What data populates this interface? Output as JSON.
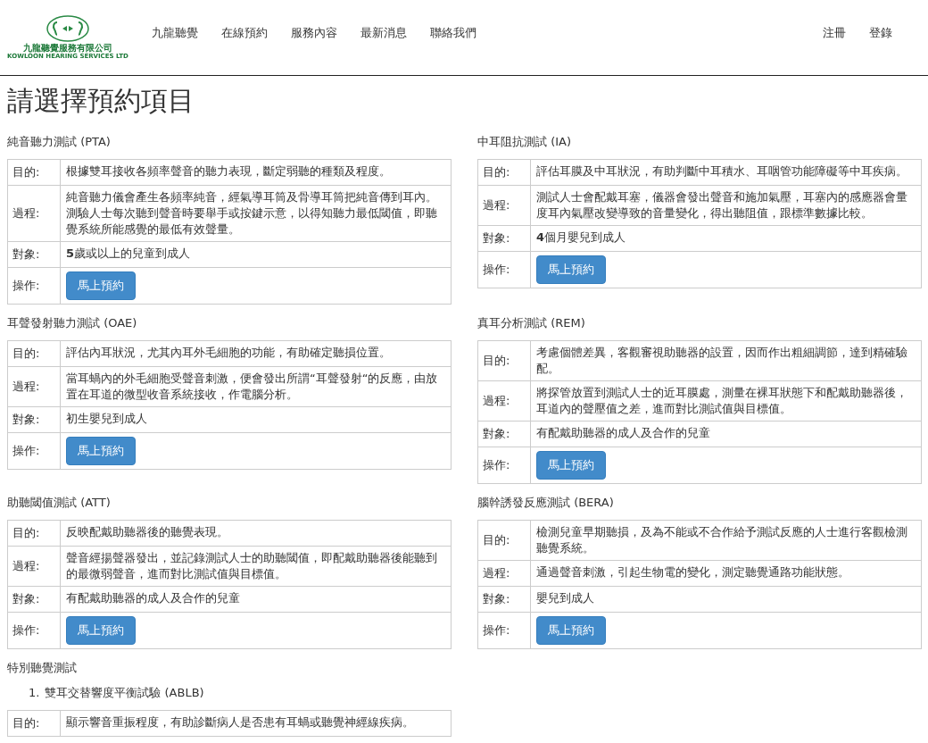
{
  "header": {
    "logo": {
      "name_zh": "九龍聽覺服務有限公司",
      "name_en": "KOWLOON HEARING SERVICES LTD"
    },
    "nav": [
      {
        "label": "九龍聽覺"
      },
      {
        "label": "在線預約"
      },
      {
        "label": "服務內容"
      },
      {
        "label": "最新消息"
      },
      {
        "label": "聯絡我們"
      }
    ],
    "account": [
      {
        "label": "注冊"
      },
      {
        "label": "登錄"
      }
    ]
  },
  "title": "請選擇預約項目",
  "tests": [
    {
      "title": "純音聽力測試 (PTA)",
      "rows": [
        {
          "kind": "text",
          "label": "目的:",
          "text": "根據雙耳接收各頻率聲音的聽力表現，斷定弱聽的種類及程度。"
        },
        {
          "kind": "text",
          "label": "過程:",
          "text": "純音聽力儀會產生各頻率純音，經氣導耳筒及骨導耳筒把純音傳到耳內。測驗人士每次聽到聲音時要舉手或按鍵示意，以得知聽力最低閾值，即聽覺系統所能感覺的最低有效聲量。"
        },
        {
          "kind": "text",
          "label": "對象:",
          "text": "**5**歲或以上的兒童到成人"
        },
        {
          "kind": "action",
          "label": "操作:",
          "text": "馬上預約"
        }
      ]
    },
    {
      "title": "中耳阻抗測試 (IA)",
      "rows": [
        {
          "kind": "text",
          "label": "目的:",
          "text": "評估耳膜及中耳狀況，有助判斷中耳積水、耳咽管功能障礙等中耳疾病。"
        },
        {
          "kind": "text",
          "label": "過程:",
          "text": "測試人士會配戴耳塞，儀器會發出聲音和施加氣壓，耳塞內的感應器會量度耳內氣壓改變導致的音量變化，得出聽阻值，跟標準數據比較。"
        },
        {
          "kind": "text",
          "label": "對象:",
          "text": "**4**個月嬰兒到成人"
        },
        {
          "kind": "action",
          "label": "操作:",
          "text": "馬上預約"
        }
      ]
    },
    {
      "title": "耳聲發射聽力測試 (OAE)",
      "rows": [
        {
          "kind": "text",
          "label": "目的:",
          "text": "評估內耳狀況，尤其內耳外毛細胞的功能，有助確定聽損位置。"
        },
        {
          "kind": "text",
          "label": "過程:",
          "text": "當耳蝸內的外毛細胞受聲音刺激，便會發出所謂“耳聲發射“的反應，由放置在耳道的微型收音系統接收，作電腦分析。"
        },
        {
          "kind": "text",
          "label": "對象:",
          "text": "初生嬰兒到成人"
        },
        {
          "kind": "action",
          "label": "操作:",
          "text": "馬上預約"
        }
      ]
    },
    {
      "title": "真耳分析測試 (REM)",
      "rows": [
        {
          "kind": "text",
          "label": "目的:",
          "text": "考慮個體差異，客觀審視助聽器的設置，因而作出粗細調節，達到精確驗配。"
        },
        {
          "kind": "text",
          "label": "過程:",
          "text": "將探管放置到測試人士的近耳膜處，測量在裸耳狀態下和配戴助聽器後，耳道內的聲壓值之差，進而對比測試值與目標值。"
        },
        {
          "kind": "text",
          "label": "對象:",
          "text": "有配戴助聽器的成人及合作的兒童"
        },
        {
          "kind": "action",
          "label": "操作:",
          "text": "馬上預約"
        }
      ]
    },
    {
      "title": "助聽閾值測試 (ATT)",
      "rows": [
        {
          "kind": "text",
          "label": "目的:",
          "text": "反映配戴助聽器後的聽覺表現。"
        },
        {
          "kind": "text",
          "label": "過程:",
          "text": "聲音經揚聲器發出，並記錄測試人士的助聽閾值，即配戴助聽器後能聽到的最微弱聲音，進而對比測試值與目標值。"
        },
        {
          "kind": "text",
          "label": "對象:",
          "text": "有配戴助聽器的成人及合作的兒童"
        },
        {
          "kind": "action",
          "label": "操作:",
          "text": "馬上預約"
        }
      ]
    },
    {
      "title": "腦幹誘發反應測試 (BERA)",
      "rows": [
        {
          "kind": "text",
          "label": "目的:",
          "text": "檢測兒童早期聽損，及為不能或不合作給予測試反應的人士進行客觀檢測聽覺系統。"
        },
        {
          "kind": "text",
          "label": "過程:",
          "text": "通過聲音刺激，引起生物電的變化，測定聽覺通路功能狀態。"
        },
        {
          "kind": "text",
          "label": "對象:",
          "text": "嬰兒到成人"
        },
        {
          "kind": "action",
          "label": "操作:",
          "text": "馬上預約"
        }
      ]
    }
  ],
  "special": {
    "title": "特別聽覺測試",
    "items": [
      {
        "number": "1.",
        "title": "雙耳交替響度平衡試驗 (ABLB)",
        "rows": [
          {
            "kind": "text",
            "label": "目的:",
            "text": "顯示響音重振程度，有助診斷病人是否患有耳蝸或聽覺神經線疾病。"
          }
        ]
      }
    ]
  }
}
